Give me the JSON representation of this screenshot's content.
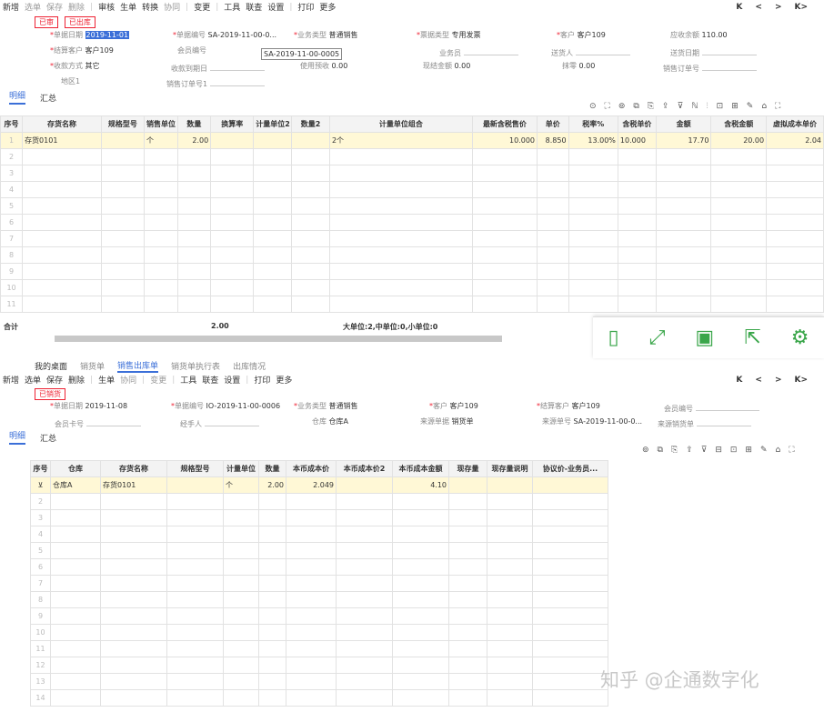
{
  "top": {
    "toolbar": [
      "新增",
      "选单",
      "保存",
      "删除",
      "审核",
      "生单",
      "转换",
      "协同",
      "变更",
      "工具",
      "联查",
      "设置",
      "打印",
      "更多"
    ],
    "nav": [
      "K",
      "<",
      ">",
      "K>"
    ],
    "badges": [
      "已审",
      "已出库"
    ],
    "form": {
      "date_l": "单据日期",
      "date_v": "2019-11-01",
      "bill_l": "单据编号",
      "bill_v": "SA-2019-11-00-0...",
      "biz_l": "业务类型",
      "biz_v": "普通销售",
      "invt_l": "票据类型",
      "invt_v": "专用发票",
      "cust_l": "客户",
      "cust_v": "客户109",
      "recv_l": "应收余额",
      "recv_v": "110.00",
      "settle_l": "结算客户",
      "settle_v": "客户109",
      "mem_l": "会员编号",
      "emp_l": "业务员",
      "ship_l": "送货人",
      "shipd_l": "送货日期",
      "pay_l": "收款方式",
      "pay_v": "其它",
      "recvdate_l": "收款到期日",
      "adv_l": "使用预收",
      "adv_v": "0.00",
      "cash_l": "现结金额",
      "cash_v": "0.00",
      "zero_l": "抹零",
      "zero_v": "0.00",
      "so_l": "销售订单号",
      "region_l": "地区1",
      "so2_l": "销售订单号1",
      "tooltip": "SA-2019-11-00-0005"
    },
    "tabs": [
      "明细",
      "汇总"
    ],
    "headers": [
      "序号",
      "存货名称",
      "规格型号",
      "销售单位",
      "数量",
      "换算率",
      "计量单位2",
      "数量2",
      "计量单位组合",
      "最新含税售价",
      "单价",
      "税率%",
      "含税单价",
      "金额",
      "含税金额",
      "虚拟成本单价"
    ],
    "row": [
      "1",
      "存货0101",
      "",
      "个",
      "2.00",
      "",
      "",
      "",
      "2个",
      "10.000",
      "8.850",
      "13.00%",
      "10.000",
      "17.70",
      "20.00",
      "2.04"
    ],
    "total_l": "合计",
    "total_q": "2.00",
    "total_u": "大单位:2,中单位:0,小单位:0"
  },
  "bottom": {
    "wtabs": [
      "我的桌面",
      "销货单",
      "销售出库单",
      "销货单执行表",
      "出库情况"
    ],
    "toolbar": [
      "新增",
      "选单",
      "保存",
      "删除",
      "生单",
      "协同",
      "变更",
      "工具",
      "联查",
      "设置",
      "打印",
      "更多"
    ],
    "badge": "已销货",
    "form": {
      "date_l": "单据日期",
      "date_v": "2019-11-08",
      "bill_l": "单据编号",
      "bill_v": "IO-2019-11-00-0006",
      "biz_l": "业务类型",
      "biz_v": "普通销售",
      "cust_l": "客户",
      "cust_v": "客户109",
      "settle_l": "结算客户",
      "settle_v": "客户109",
      "mem_l": "会员编号",
      "card_l": "会员卡号",
      "handler_l": "经手人",
      "wh_l": "仓库",
      "wh_v": "仓库A",
      "src_l": "来源单据",
      "src_v": "销货单",
      "srcno_l": "来源单号",
      "srcno_v": "SA-2019-11-00-0...",
      "srcs_l": "来源销货单"
    },
    "tabs": [
      "明细",
      "汇总"
    ],
    "headers": [
      "序号",
      "仓库",
      "存货名称",
      "规格型号",
      "计量单位",
      "数量",
      "本币成本价",
      "本币成本价2",
      "本币成本金额",
      "现存量",
      "现存量说明",
      "协议价-业务员..."
    ],
    "row": [
      "仓库A",
      "存货0101",
      "",
      "个",
      "2.00",
      "2.049",
      "",
      "4.10",
      "",
      "",
      ""
    ]
  },
  "watermark": "知乎 @企通数字化"
}
